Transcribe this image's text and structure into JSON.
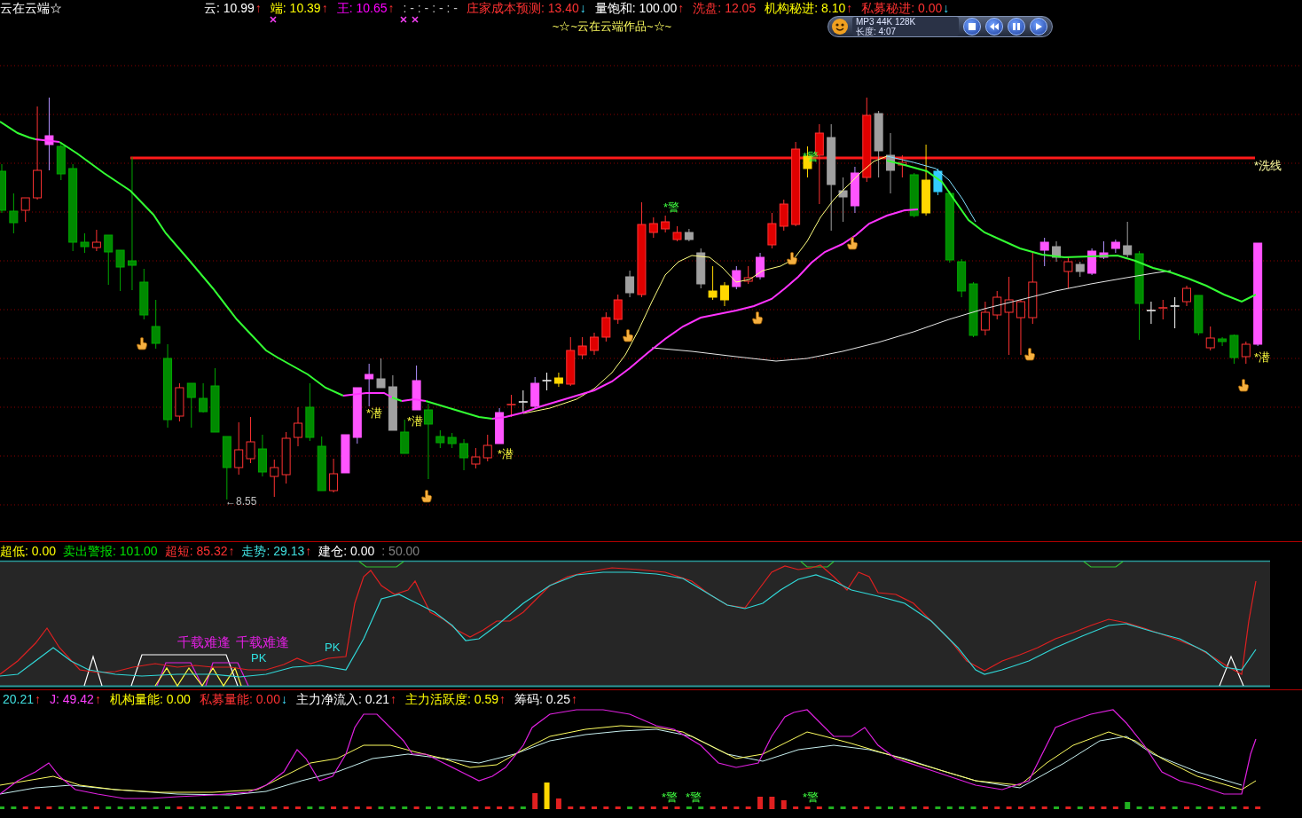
{
  "title": "云在云端☆",
  "header": [
    {
      "text": "云: 10.99",
      "arrow": "↑",
      "rising": true,
      "color": "#ffffff"
    },
    {
      "text": "端: 10.39",
      "arrow": "↑",
      "rising": true,
      "color": "#ffff00"
    },
    {
      "text": "王: 10.65",
      "arrow": "↑",
      "rising": true,
      "color": "#ff00ff"
    },
    {
      "text": ": - : - : - : -",
      "color": "#c0c0c0"
    },
    {
      "text": "庄家成本预测: 13.40",
      "arrow": "↓",
      "rising": false,
      "color": "#ff3232"
    },
    {
      "text": "量饱和: 100.00",
      "arrow": "↑",
      "rising": true,
      "color": "#ffffff"
    },
    {
      "text": "洗盘: 12.05",
      "color": "#ff3232"
    },
    {
      "text": "机构秘进: 8.10",
      "arrow": "↑",
      "rising": true,
      "color": "#ffff00"
    },
    {
      "text": "私募秘进: 0.00",
      "arrow": "↓",
      "rising": false,
      "color": "#ff3232"
    }
  ],
  "player": {
    "info": "MP3 44K 128K",
    "length": "长度: 4:07"
  },
  "main_chart": {
    "subtitle": "~☆~云在云端作品~☆~",
    "annotations": [
      {
        "text": "*潜",
        "kind": "buy"
      },
      {
        "text": "*潜",
        "kind": "buy"
      },
      {
        "text": "*潜",
        "kind": "buy"
      },
      {
        "text": "*警",
        "kind": "warn"
      },
      {
        "text": "*警",
        "kind": "warn"
      },
      {
        "text": "*洗线",
        "kind": "level"
      },
      {
        "text": "*潜",
        "kind": "buy"
      }
    ],
    "low_label": "←8.55"
  },
  "indicator_1": {
    "readings": [
      {
        "text": "超低: 0.00",
        "color": "#ffff00"
      },
      {
        "text": "卖出警报: 101.00",
        "color": "#00e000"
      },
      {
        "text": "超短: 85.32",
        "arrow": "↑",
        "rising": true,
        "color": "#ff3232"
      },
      {
        "text": "走势: 29.13",
        "arrow": "↑",
        "rising": true,
        "color": "#40e0e0"
      },
      {
        "text": "建仓: 0.00",
        "color": "#ffffff"
      },
      {
        "text": ": 50.00",
        "color": "#808080"
      }
    ],
    "annotations": [
      {
        "text": "千载难逢",
        "kind": "signal"
      },
      {
        "text": "千载难逢",
        "kind": "signal"
      },
      {
        "text": "PK",
        "kind": "cross"
      },
      {
        "text": "PK",
        "kind": "cross"
      }
    ]
  },
  "indicator_2": {
    "readings": [
      {
        "text": "20.21",
        "arrow": "↑",
        "rising": true,
        "color": "#40e0e0"
      },
      {
        "text": "J: 49.42",
        "arrow": "↑",
        "rising": true,
        "color": "#ff40ff"
      },
      {
        "text": "机构量能: 0.00",
        "color": "#ffff00"
      },
      {
        "text": "私募量能: 0.00",
        "arrow": "↓",
        "rising": false,
        "color": "#ff3232"
      },
      {
        "text": "主力净流入: 0.21",
        "arrow": "↑",
        "rising": true,
        "color": "#ffffff"
      },
      {
        "text": "主力活跃度: 0.59",
        "arrow": "↑",
        "rising": true,
        "color": "#ffff00"
      },
      {
        "text": "筹码: 0.25",
        "arrow": "↑",
        "rising": true,
        "color": "#ffffff"
      }
    ],
    "annotations": [
      {
        "text": "*警",
        "kind": "warn"
      },
      {
        "text": "*警",
        "kind": "warn"
      },
      {
        "text": "*警",
        "kind": "warn"
      }
    ]
  }
}
